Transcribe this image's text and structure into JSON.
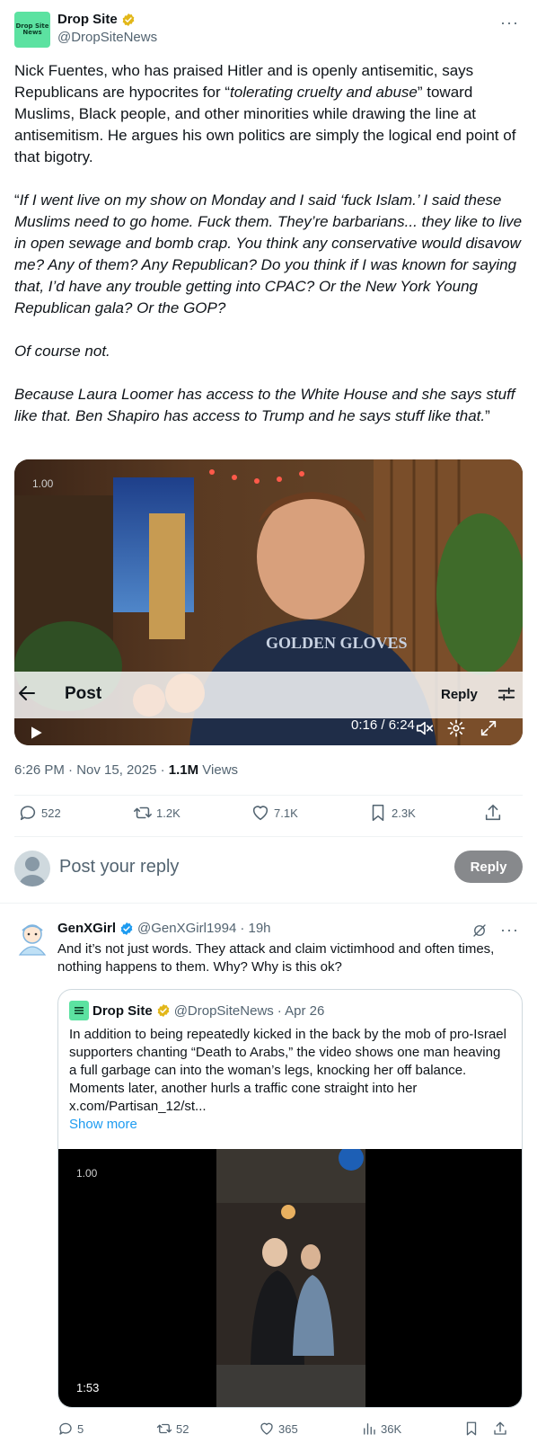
{
  "post": {
    "author_name": "Drop Site",
    "author_handle": "@DropSiteNews",
    "avatar_text": "Drop Site News",
    "more_icon": "more-dots-icon",
    "text": {
      "p1_a": "Nick Fuentes, who has praised Hitler and is openly antisemitic, says Republicans are hypocrites for “",
      "p1_em": "tolerating cruelty and abuse",
      "p1_b": "” toward Muslims, Black people, and other minorities while drawing the line at antisemitism. He argues his own politics are simply the logical end point of that bigotry.",
      "p2_a": "“",
      "p2_em": "If I went live on my show on Monday and I said ‘fuck Islam.’ I said these Muslims need to go home. Fuck them. They’re barbarians... they like to live in open sewage and bomb crap. You think any conservative would disavow me? Any of them? Any Republican? Do you think if I was known for saying that, I’d have any trouble getting into CPAC? Or the New York Young Republican gala? Or the GOP?",
      "p3_em": "Of course not.",
      "p4_em": "Because Laura Loomer has access to the White House and she says stuff like that. Ben Shapiro has access to Trump and he says stuff like that.",
      "p4_b": "”"
    },
    "video": {
      "speed": "1.00",
      "time": "0:16 / 6:24"
    },
    "timestamp": "6:26 PM · Nov 15, 2025 · ",
    "views_count": "1.1M",
    "views_label": " Views",
    "stats": {
      "replies": "522",
      "reposts": "1.2K",
      "likes": "7.1K",
      "bookmarks": "2.3K"
    }
  },
  "nav_overlay": {
    "title": "Post",
    "reply_label": "Reply"
  },
  "composer": {
    "placeholder": "Post your reply",
    "button": "Reply"
  },
  "reply": {
    "author_name": "GenXGirl",
    "author_handle": "@GenXGirl1994",
    "time": "· 19h",
    "text": "And it’s not just words. They attack and claim victimhood and often times, nothing happens to them. Why? Why is this ok?",
    "quote": {
      "author_name": "Drop Site",
      "author_handle": "@DropSiteNews",
      "time": "· Apr 26",
      "text": "In addition to being repeatedly kicked in the back by the mob of pro-Israel supporters chanting “Death to Arabs,” the video shows one man heaving a full garbage can into the woman’s legs, knocking her off balance. Moments later, another hurls a traffic cone straight into her x.com/Partisan_12/st...",
      "show_more": "Show more",
      "video_speed": "1.00",
      "video_duration": "1:53"
    },
    "stats": {
      "replies": "5",
      "reposts": "52",
      "likes": "365",
      "views": "36K"
    }
  },
  "colors": {
    "accent": "#1d9bf0",
    "muted": "#536471",
    "text": "#0f1419",
    "avatar_green": "#5ce2a1",
    "gold_badge": "#e2b719"
  }
}
